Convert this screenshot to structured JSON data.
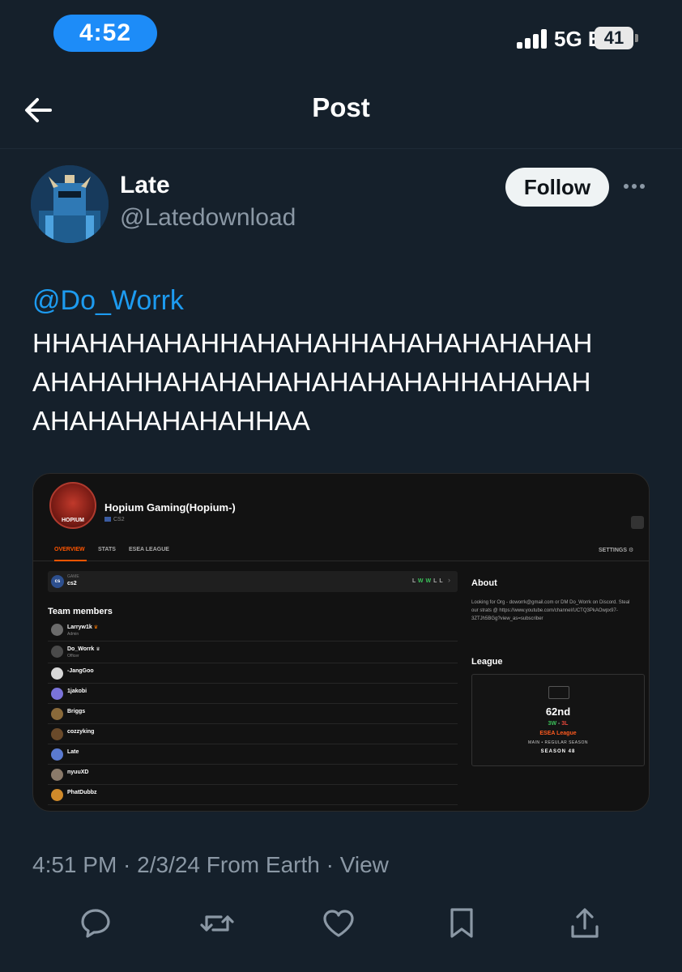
{
  "status_bar": {
    "time": "4:52",
    "network": "5G E",
    "battery": "41"
  },
  "header": {
    "title": "Post"
  },
  "author": {
    "display_name": "Late",
    "handle": "@Latedownload",
    "follow_label": "Follow"
  },
  "tweet": {
    "mention": "@Do_Worrk",
    "lines": [
      "HHAHAHAHAHHAHAHAHHAHAHAHAHAHAH",
      "AHAHAHHAHAHAHAHAHAHAHAHHAHAHAH",
      "AHAHAHAHAHAHHAA"
    ]
  },
  "media": {
    "logo_text": "HOPIUM",
    "team_name": "Hopium Gaming(Hopium-)",
    "game_tag": "CS2",
    "tabs": [
      "OVERVIEW",
      "STATS",
      "ESEA LEAGUE"
    ],
    "settings_label": "SETTINGS ⚙",
    "game_row": {
      "badge": "cs",
      "label": "GAME",
      "value": "cs2",
      "form": [
        "L",
        "W",
        "W",
        "L",
        "L"
      ]
    },
    "team_members_title": "Team members",
    "members": [
      {
        "name": "Larryw1k",
        "role": "Admin",
        "crown": true
      },
      {
        "name": "Do_Worrk",
        "role": "Officer",
        "crown": true
      },
      {
        "name": "-JangGoo",
        "role": "",
        "crown": false
      },
      {
        "name": "1jakobi",
        "role": "",
        "crown": false
      },
      {
        "name": "Briggs",
        "role": "",
        "crown": false
      },
      {
        "name": "cozzyking",
        "role": "",
        "crown": false
      },
      {
        "name": "Late",
        "role": "",
        "crown": false
      },
      {
        "name": "nyuuXD",
        "role": "",
        "crown": false
      },
      {
        "name": "PhatDubbz",
        "role": "",
        "crown": false
      }
    ],
    "about_title": "About",
    "about_text": "Looking for Org - doworrk@gmail.com or DM Do_Worrk on Discord. Steal our strats @ https://www.youtube.com/channel/UCTQ3PkAOwpx97-3ZTJh5BGg?view_as=subscriber",
    "league_title": "League",
    "league": {
      "rank": "62nd",
      "wins": "3W",
      "losses": "3L",
      "name": "ESEA League",
      "stage": "MAIN • REGULAR SEASON",
      "season": "SEASON 48"
    }
  },
  "meta": {
    "text": "4:51 PM · 2/3/24 From Earth · View"
  },
  "actions": [
    "reply-icon",
    "retweet-icon",
    "like-icon",
    "bookmark-icon",
    "share-icon"
  ],
  "colors": {
    "background": "#15202b",
    "accent": "#1d9bf0",
    "time_pill": "#1d8cf8",
    "faceit_orange": "#ff5500"
  }
}
